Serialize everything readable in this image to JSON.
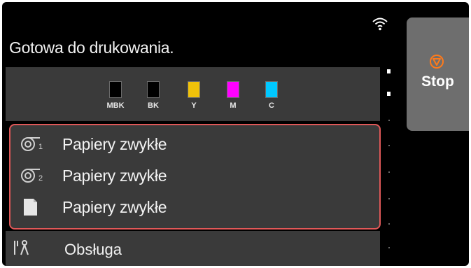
{
  "status": {
    "message": "Gotowa do drukowania.",
    "wifi_icon": "wifi-icon"
  },
  "inks": [
    {
      "label": "MBK",
      "color": "#000000"
    },
    {
      "label": "BK",
      "color": "#000000"
    },
    {
      "label": "Y",
      "color": "#f0c20a"
    },
    {
      "label": "M",
      "color": "#ff00ff"
    },
    {
      "label": "C",
      "color": "#00c8ff"
    }
  ],
  "paper_sources": [
    {
      "icon": "roll-1-icon",
      "label": "Papiery zwykłe"
    },
    {
      "icon": "roll-2-icon",
      "label": "Papiery zwykłe"
    },
    {
      "icon": "cut-sheet-icon",
      "label": "Papiery zwykłe"
    }
  ],
  "menu": {
    "icon": "maintenance-icon",
    "label": "Obsługa"
  },
  "stop_button": {
    "label": "Stop",
    "icon": "stop-icon",
    "icon_color": "#ff7a1a"
  },
  "colors": {
    "background": "#000000",
    "panel": "#3a3a3a",
    "highlight_border": "#e05858",
    "stop_button_bg": "#6e6e6e"
  }
}
